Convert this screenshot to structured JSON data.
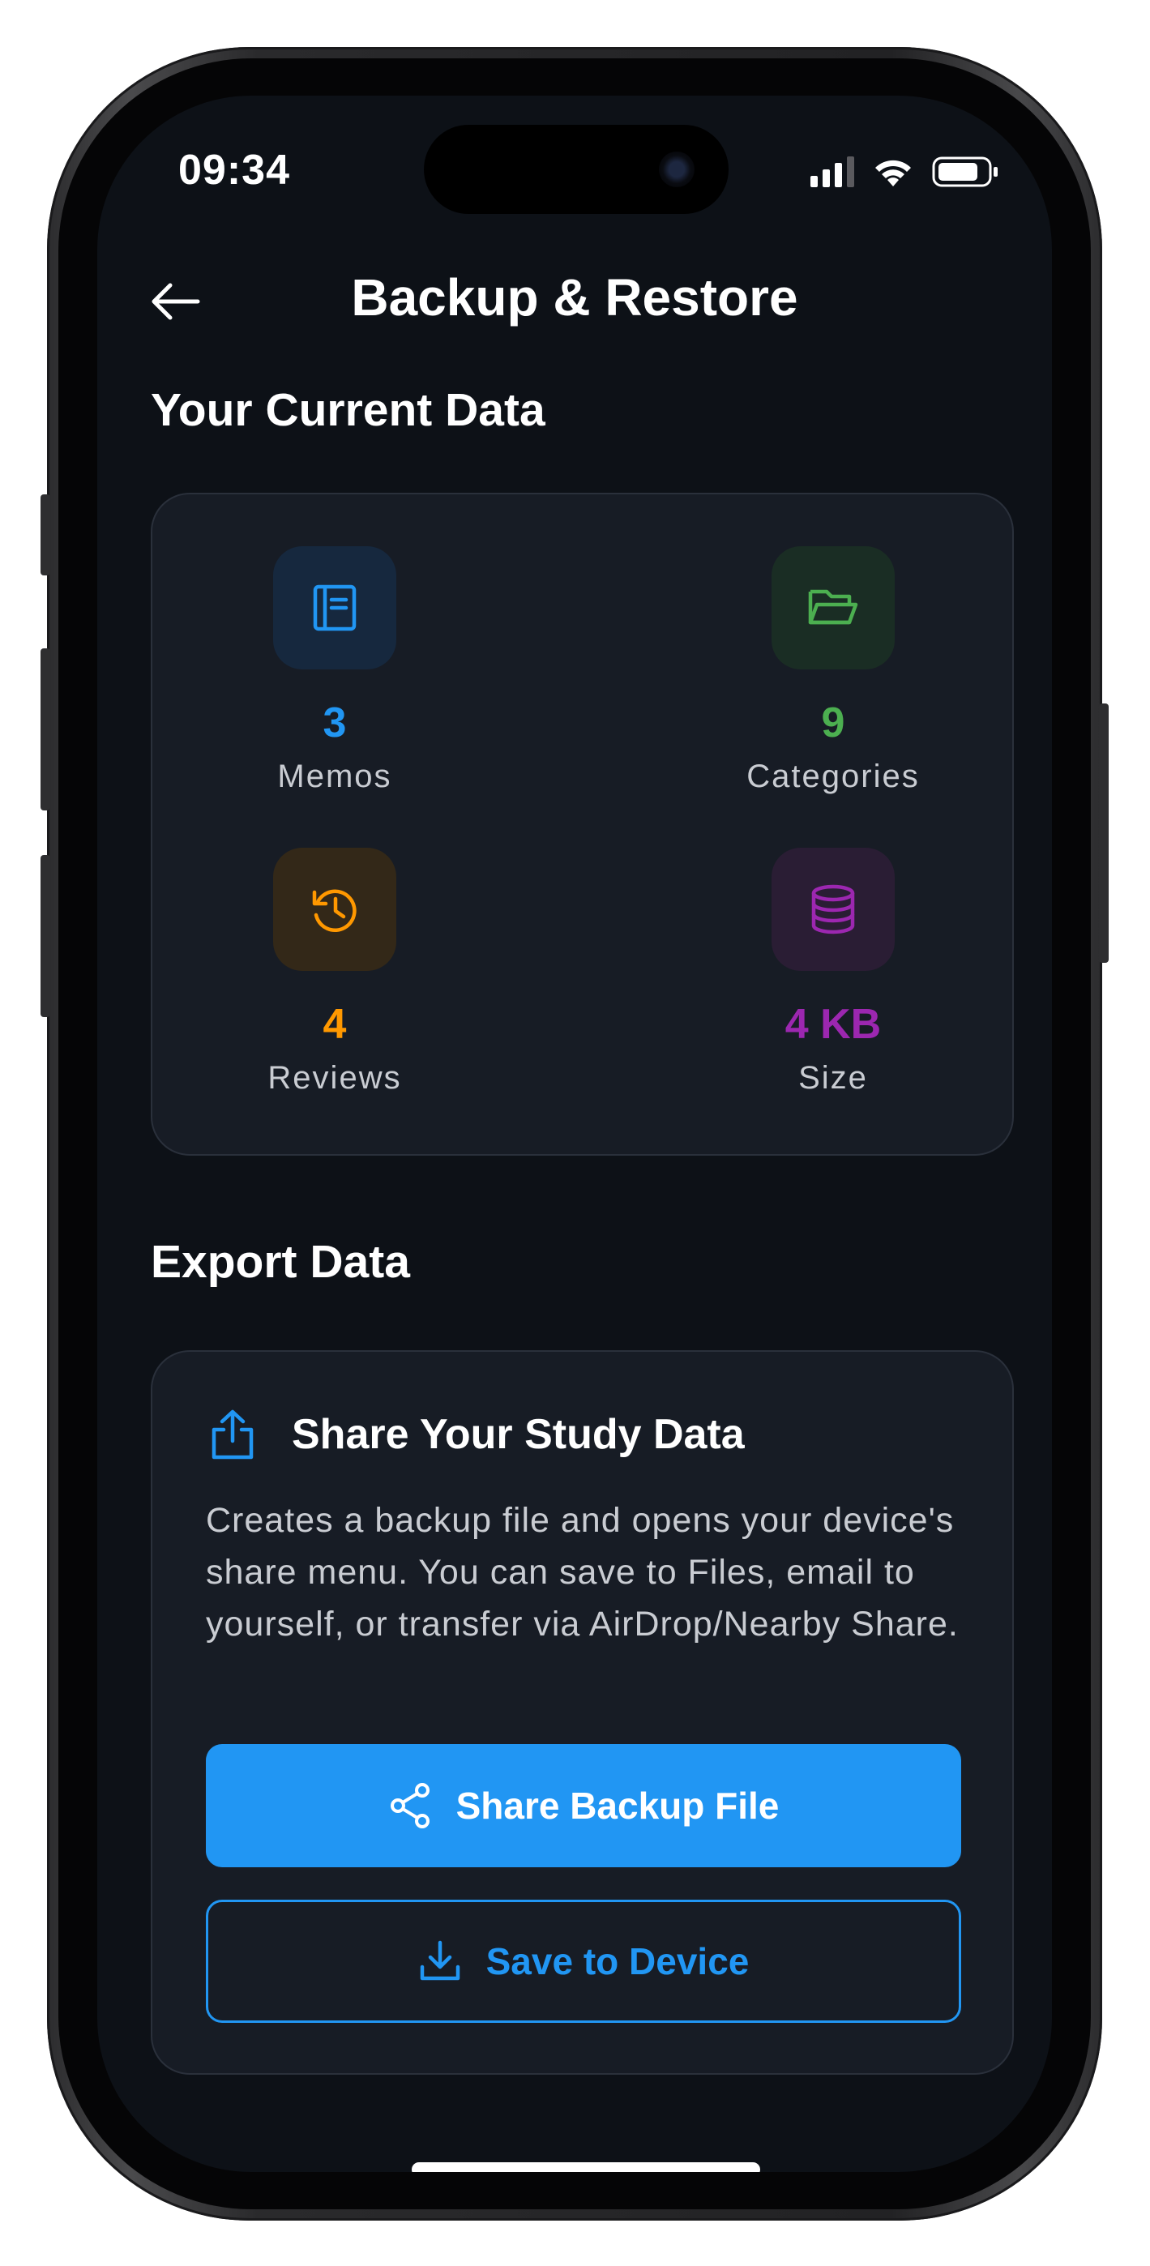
{
  "status_bar": {
    "time": "09:34",
    "icons": [
      "cellular-signal-icon",
      "wifi-icon",
      "battery-icon"
    ]
  },
  "nav": {
    "back_icon": "arrow-left-icon",
    "title": "Backup & Restore"
  },
  "current_data": {
    "heading": "Your Current Data",
    "stats": [
      {
        "value": "3",
        "label": "Memos",
        "icon": "notebook-icon",
        "color": "#2196f3"
      },
      {
        "value": "9",
        "label": "Categories",
        "icon": "folder-icon",
        "color": "#4caf50"
      },
      {
        "value": "4",
        "label": "Reviews",
        "icon": "history-icon",
        "color": "#ff9800"
      },
      {
        "value": "4 KB",
        "label": "Size",
        "icon": "database-icon",
        "color": "#9c27b0"
      }
    ]
  },
  "export": {
    "heading": "Export Data",
    "card_icon": "share-upload-icon",
    "card_title": "Share Your Study Data",
    "description": "Creates a backup file and opens your device's share menu. You can save to Files, email to yourself, or transfer via AirDrop/Nearby Share.",
    "share_button_label": "Share Backup File",
    "share_button_icon": "share-nodes-icon",
    "save_button_label": "Save to Device",
    "save_button_icon": "download-icon"
  },
  "colors": {
    "background": "#0d1117",
    "card": "#171c25",
    "accent": "#2196f3"
  }
}
